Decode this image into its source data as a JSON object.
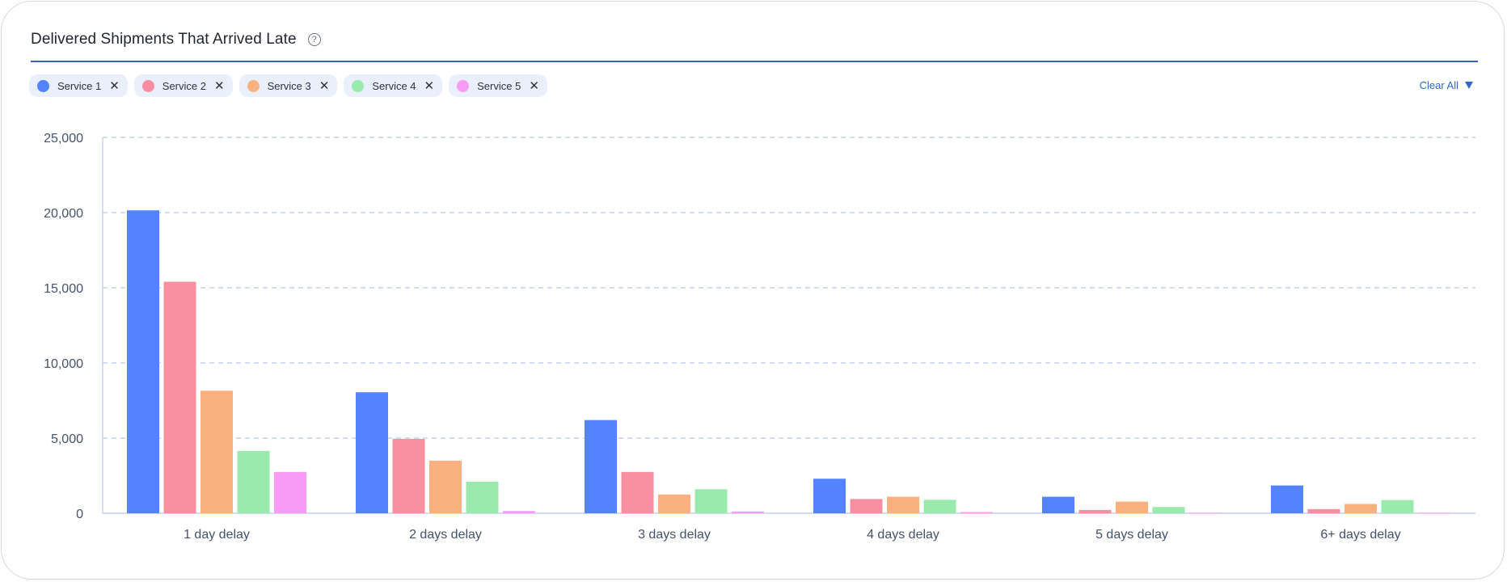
{
  "header": {
    "title": "Delivered Shipments That Arrived Late",
    "help_icon": "question-circle-icon"
  },
  "filters": {
    "chips": [
      {
        "label": "Service 1",
        "color": "#5383ff"
      },
      {
        "label": "Service 2",
        "color": "#f78fa1"
      },
      {
        "label": "Service 3",
        "color": "#fbb07f"
      },
      {
        "label": "Service 4",
        "color": "#9aeaae"
      },
      {
        "label": "Service 5",
        "color": "#f79cf4"
      }
    ],
    "remove_icon": "close-icon",
    "clear_all_label": "Clear All",
    "clear_all_icon": "triangle-down-icon"
  },
  "chart_data": {
    "type": "bar",
    "categories": [
      "1 day delay",
      "2 days delay",
      "3 days delay",
      "4 days delay",
      "5 days delay",
      "6+ days delay"
    ],
    "series": [
      {
        "name": "Service 1",
        "color": "#5383ff",
        "values": [
          20150,
          8050,
          6200,
          2300,
          1100,
          1850
        ]
      },
      {
        "name": "Service 2",
        "color": "#f78fa1",
        "values": [
          15400,
          4950,
          2750,
          950,
          220,
          280
        ]
      },
      {
        "name": "Service 3",
        "color": "#fbb07f",
        "values": [
          8150,
          3500,
          1250,
          1100,
          780,
          620
        ]
      },
      {
        "name": "Service 4",
        "color": "#9aeaae",
        "values": [
          4150,
          2100,
          1600,
          900,
          420,
          880
        ]
      },
      {
        "name": "Service 5",
        "color": "#f79cf4",
        "values": [
          2750,
          150,
          120,
          80,
          40,
          40
        ]
      }
    ],
    "yticks": [
      0,
      5000,
      10000,
      15000,
      20000,
      25000
    ],
    "ytick_labels": [
      "0",
      "5,000",
      "10,000",
      "15,000",
      "20,000",
      "25,000"
    ],
    "ylim": [
      0,
      25000
    ],
    "grid": true,
    "grid_style": "dashed",
    "legend": "top-left"
  }
}
